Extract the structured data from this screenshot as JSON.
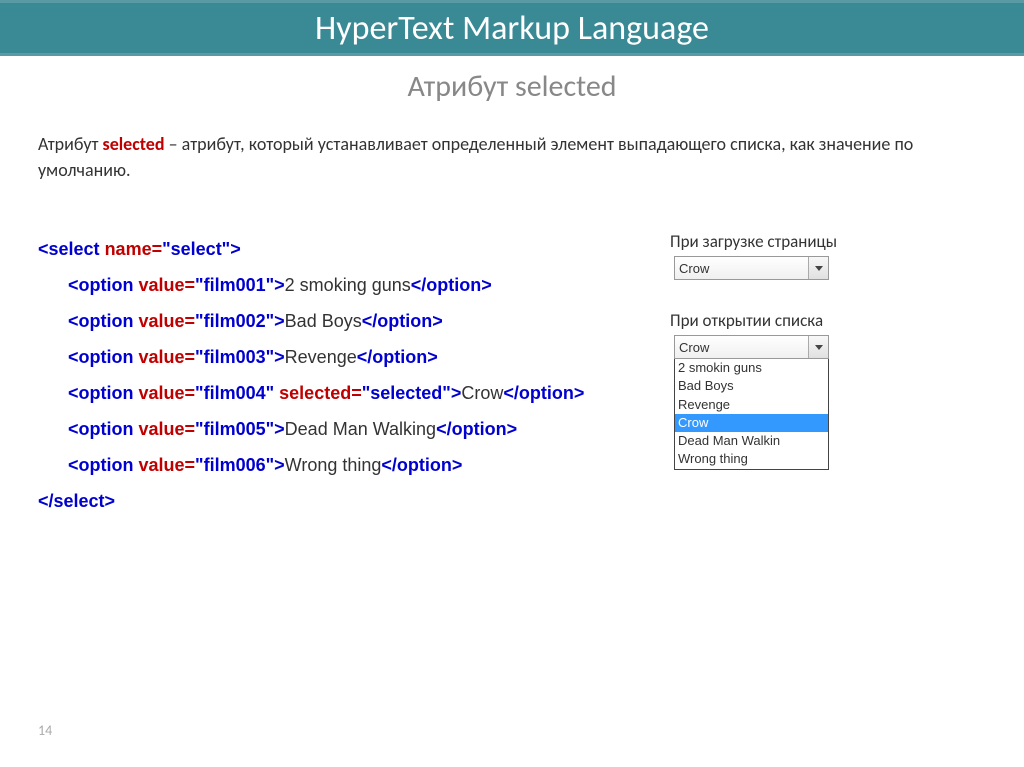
{
  "header": {
    "title": "HyperText Markup Language"
  },
  "subtitle": "Атрибут selected",
  "desc": {
    "pre": "Атрибут ",
    "kw": "selected",
    "post": " – атрибут, который устанавливает определенный элемент выпадающего списка, как значение по умолчанию."
  },
  "code": {
    "open_tag": "<select ",
    "open_attr": "name=",
    "open_val": "\"select\"",
    "open_close": ">",
    "options": [
      {
        "open": "<option ",
        "attr": "value=",
        "val": "\"film001\"",
        "close": ">",
        "text": "2 smoking guns",
        "end": "</option>"
      },
      {
        "open": "<option ",
        "attr": "value=",
        "val": "\"film002\"",
        "close": ">",
        "text": "Bad Boys",
        "end": "</option>"
      },
      {
        "open": "<option ",
        "attr": "value=",
        "val": "\"film003\"",
        "close": ">",
        "text": "Revenge",
        "end": "</option>"
      },
      {
        "open": "<option ",
        "attr": "value=",
        "val": "\"film004\"",
        "attr2": " selected=",
        "val2": "\"selected\"",
        "close": ">",
        "text": "Crow",
        "end": "</option>"
      },
      {
        "open": "<option ",
        "attr": "value=",
        "val": "\"film005\"",
        "close": ">",
        "text": "Dead Man Walking",
        "end": "</option>"
      },
      {
        "open": "<option ",
        "attr": "value=",
        "val": "\"film006\"",
        "close": ">",
        "text": "Wrong thing",
        "end": "</option>"
      }
    ],
    "close_tag": "</select>"
  },
  "right": {
    "closed_label": "При загрузке страницы",
    "closed_value": "Crow",
    "open_label": "При открытии списка",
    "open_value": "Crow",
    "list": [
      "2 smokin guns",
      "Bad Boys",
      "Revenge",
      "Crow",
      "Dead Man Walkin",
      "Wrong thing"
    ],
    "selected_index": 3
  },
  "page_number": "14"
}
